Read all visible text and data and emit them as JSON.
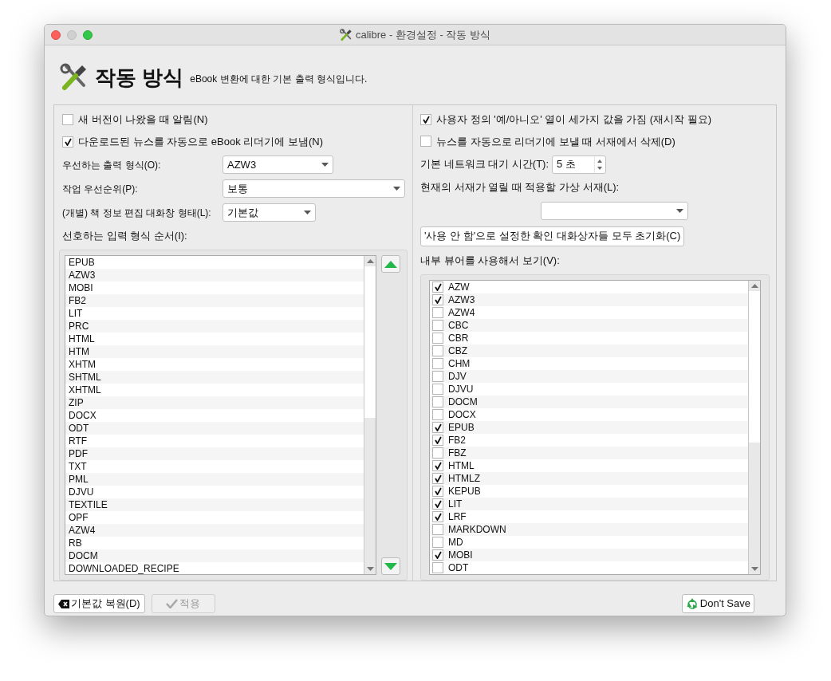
{
  "window": {
    "title": "calibre - 환경설정 - 작동 방식"
  },
  "header": {
    "title": "작동 방식",
    "subtitle": "eBook 변환에 대한 기본 출력 형식입니다."
  },
  "left": {
    "checkboxes": [
      {
        "label": "새 버전이 나왔을 때 알림(N)",
        "checked": false
      },
      {
        "label": "다운로드된 뉴스를 자동으로 eBook 리더기에 보냄(N)",
        "checked": true
      }
    ],
    "dropdowns": [
      {
        "label": "우선하는 출력 형식(O):",
        "value": "AZW3"
      },
      {
        "label": "작업 우선순위(P):",
        "value": "보통"
      },
      {
        "label": "(개별) 책 정보 편집 대화창 형태(L):",
        "value": "기본값"
      }
    ],
    "input_order_label": "선호하는 입력 형식 순서(I):",
    "input_order": [
      "EPUB",
      "AZW3",
      "MOBI",
      "FB2",
      "LIT",
      "PRC",
      "HTML",
      "HTM",
      "XHTM",
      "SHTML",
      "XHTML",
      "ZIP",
      "DOCX",
      "ODT",
      "RTF",
      "PDF",
      "TXT",
      "PML",
      "DJVU",
      "TEXTILE",
      "OPF",
      "AZW4",
      "RB",
      "DOCM",
      "DOWNLOADED_RECIPE"
    ]
  },
  "right": {
    "checkboxes": [
      {
        "label": "사용자 정의 '예/아니오' 열이 세가지 값을 가짐 (재시작 필요)",
        "checked": true
      },
      {
        "label": "뉴스를 자동으로 리더기에 보낼 때 서재에서 삭제(D)",
        "checked": false
      }
    ],
    "timeout": {
      "label": "기본 네트워크 대기 시간(T):",
      "value": "5 초"
    },
    "virtual_library_label": "현재의 서재가 열릴 때 적용할 가상 서재(L):",
    "reset_button": "'사용 안 함'으로 설정한 확인 대화상자들 모두 초기화(C)",
    "viewer_label": "내부 뷰어를 사용해서 보기(V):",
    "viewer_formats": [
      {
        "label": "AZW",
        "checked": true
      },
      {
        "label": "AZW3",
        "checked": true
      },
      {
        "label": "AZW4",
        "checked": false
      },
      {
        "label": "CBC",
        "checked": false
      },
      {
        "label": "CBR",
        "checked": false
      },
      {
        "label": "CBZ",
        "checked": false
      },
      {
        "label": "CHM",
        "checked": false
      },
      {
        "label": "DJV",
        "checked": false
      },
      {
        "label": "DJVU",
        "checked": false
      },
      {
        "label": "DOCM",
        "checked": false
      },
      {
        "label": "DOCX",
        "checked": false
      },
      {
        "label": "EPUB",
        "checked": true
      },
      {
        "label": "FB2",
        "checked": true
      },
      {
        "label": "FBZ",
        "checked": false
      },
      {
        "label": "HTML",
        "checked": true
      },
      {
        "label": "HTMLZ",
        "checked": true
      },
      {
        "label": "KEPUB",
        "checked": true
      },
      {
        "label": "LIT",
        "checked": true
      },
      {
        "label": "LRF",
        "checked": true
      },
      {
        "label": "MARKDOWN",
        "checked": false
      },
      {
        "label": "MD",
        "checked": false
      },
      {
        "label": "MOBI",
        "checked": true
      },
      {
        "label": "ODT",
        "checked": false
      }
    ]
  },
  "footer": {
    "restore_button": "기본값 복원(D)",
    "apply_button": {
      "label": "적용",
      "disabled": true
    },
    "dont_save_button": "Don't Save"
  }
}
